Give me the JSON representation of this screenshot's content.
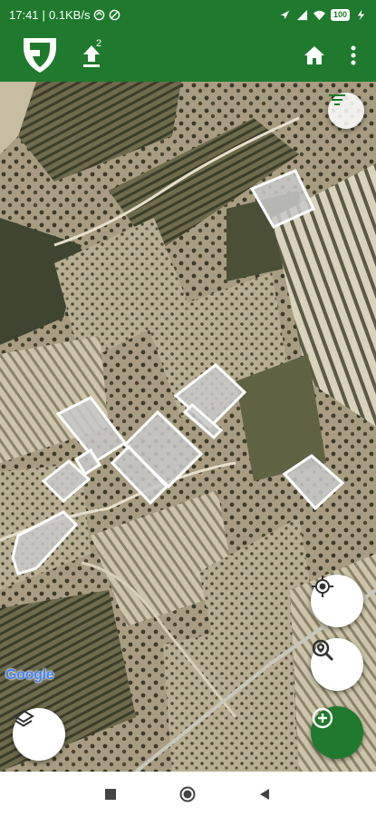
{
  "status_bar": {
    "time": "17:41",
    "net_speed": "0.1KB/s",
    "battery": "100",
    "icons": [
      "sync-icon",
      "no-disturb-icon",
      "location-icon",
      "signal-icon",
      "wifi-icon",
      "battery-icon",
      "charging-icon"
    ]
  },
  "app_bar": {
    "logo": "shield-logo-icon",
    "upload_count": "2",
    "icons": [
      "upload-icon",
      "home-icon",
      "more-vert-icon"
    ]
  },
  "map": {
    "attribution": "Google",
    "map_type": "satellite",
    "field_polygon_count": 10,
    "controls": [
      "filter-icon",
      "my-location-icon",
      "zoom-search-icon",
      "layers-icon",
      "add-icon"
    ]
  },
  "colors": {
    "primary": "#1f7a2e",
    "field_fill": "#c9c9c9",
    "field_stroke": "#ffffff"
  },
  "nav_bar": {
    "icons": [
      "recents-square-icon",
      "home-circle-icon",
      "back-triangle-icon"
    ]
  }
}
